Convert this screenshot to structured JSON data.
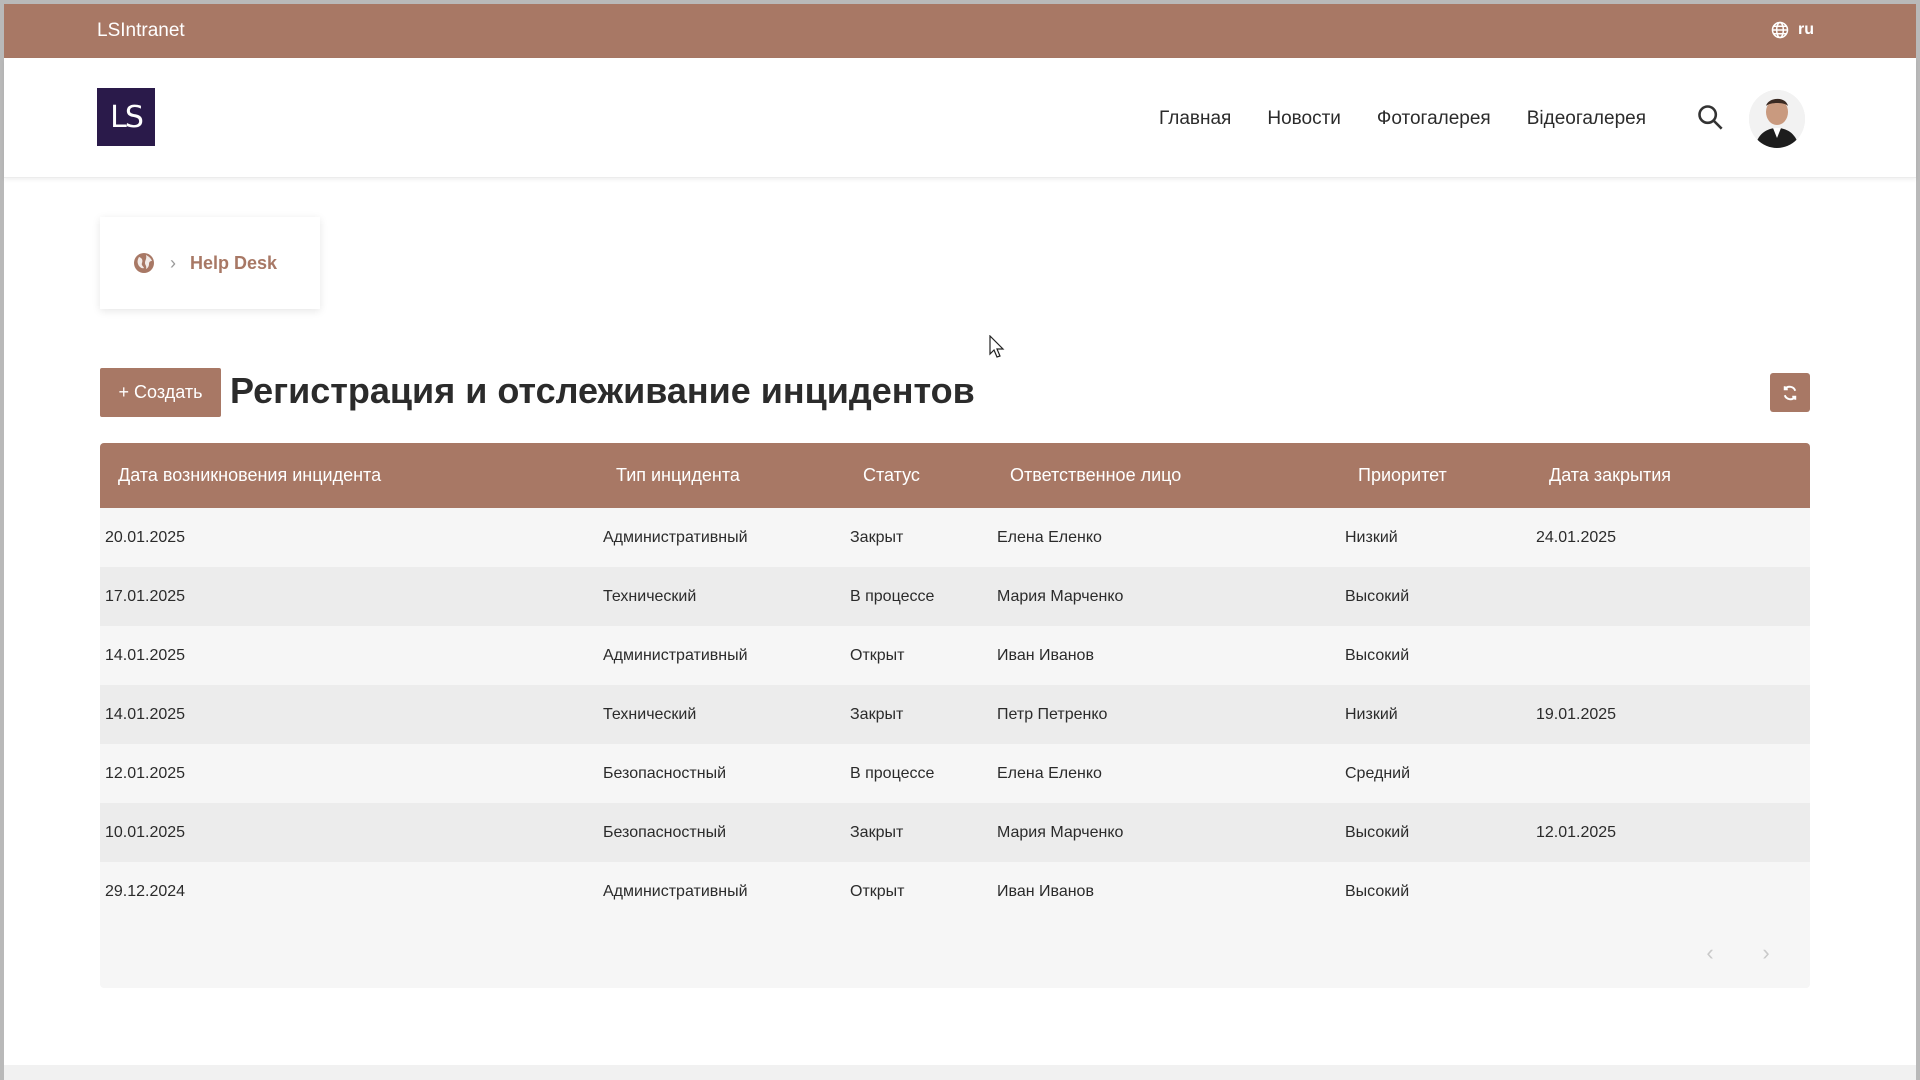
{
  "topbar": {
    "brand": "LSIntranet",
    "lang": "ru"
  },
  "header": {
    "logo_text": "LS",
    "nav": [
      "Главная",
      "Новости",
      "Фотогалерея",
      "Відеогалерея"
    ]
  },
  "breadcrumb": {
    "current": "Help Desk"
  },
  "page": {
    "create_label": "+ Создать",
    "title": "Регистрация и отслеживание инцидентов"
  },
  "table": {
    "headers": [
      "Дата возникновения инцидента",
      "Тип инцидента",
      "Статус",
      "Ответственное лицо",
      "Приоритет",
      "Дата закрытия"
    ],
    "rows": [
      [
        "20.01.2025",
        "Административный",
        "Закрыт",
        "Елена Еленко",
        "Низкий",
        "24.01.2025"
      ],
      [
        "17.01.2025",
        "Технический",
        "В процессе",
        "Мария Марченко",
        "Высокий",
        ""
      ],
      [
        "14.01.2025",
        "Административный",
        "Открыт",
        "Иван Иванов",
        "Высокий",
        ""
      ],
      [
        "14.01.2025",
        "Технический",
        "Закрыт",
        "Петр Петренко",
        "Низкий",
        "19.01.2025"
      ],
      [
        "12.01.2025",
        "Безопасностный",
        "В процессе",
        "Елена Еленко",
        "Средний",
        ""
      ],
      [
        "10.01.2025",
        "Безопасностный",
        "Закрыт",
        "Мария Марченко",
        "Высокий",
        "12.01.2025"
      ],
      [
        "29.12.2024",
        "Административный",
        "Открыт",
        "Иван Иванов",
        "Высокий",
        ""
      ]
    ]
  },
  "colors": {
    "accent": "#a87865",
    "logo_bg": "#2a1a4a"
  },
  "icons": {
    "lang": "globe-icon",
    "search": "search-icon",
    "home": "home-globe-icon",
    "refresh": "refresh-icon",
    "prev": "chevron-left-icon",
    "next": "chevron-right-icon"
  }
}
